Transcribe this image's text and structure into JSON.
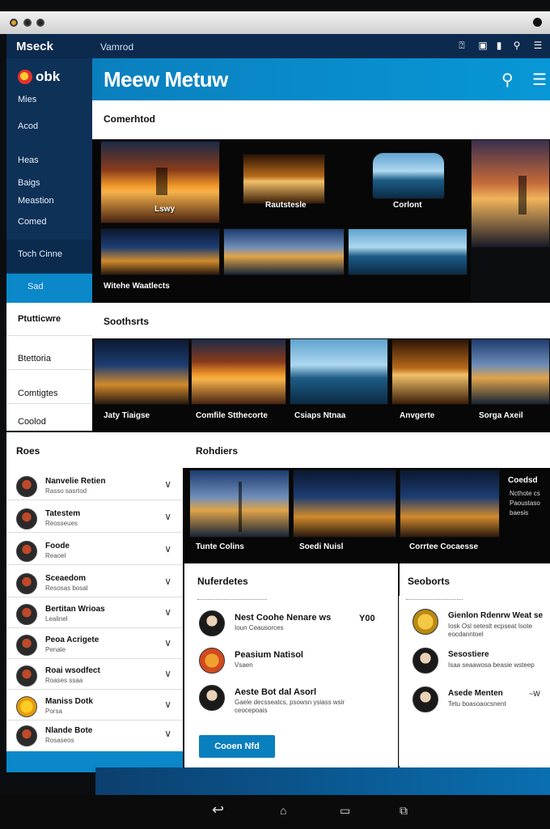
{
  "window": {
    "brand": "Mseck",
    "crumb": "Vamrod"
  },
  "sidebar": {
    "logo_text": "obk",
    "items": [
      "Mies",
      "Acod",
      "Heas",
      "Baigs",
      "Meastion",
      "Comed",
      "Toch Cinne",
      "Sad"
    ],
    "sections": [
      "Ptutticwre",
      "Btettoria",
      "Comtigtes",
      "Coolod"
    ],
    "roes_label": "Roes"
  },
  "banner": {
    "title": "Meew Metuw"
  },
  "featured": {
    "title": "Comerhtod",
    "tiles": [
      "Lswy",
      "Rautstesle",
      "Corlont",
      "Witehe Waatlects"
    ]
  },
  "sotheerts": {
    "title": "Soothsrts",
    "tiles": [
      "Jaty Tiaigse",
      "Comfile Stthecorte",
      "Csiaps Ntnaa",
      "Anvgerte",
      "Sorga Axeil"
    ]
  },
  "list": {
    "rows": [
      {
        "title": "Nanvelie Retien",
        "sub": "Rasso sasrtod"
      },
      {
        "title": "Tatestem",
        "sub": "Reosseues"
      },
      {
        "title": "Foode",
        "sub": "Reaoel"
      },
      {
        "title": "Sceaedom",
        "sub": "Resosas bosal"
      },
      {
        "title": "Bertitan Wrioas",
        "sub": "Lealinel"
      },
      {
        "title": "Peoa Acrigete",
        "sub": "Penale"
      },
      {
        "title": "Roai wsodfect",
        "sub": "Roases ssaa"
      },
      {
        "title": "Maniss Dotk",
        "sub": "Porsa"
      },
      {
        "title": "Nlande Bote",
        "sub": "Rosaseos"
      }
    ]
  },
  "rohders": {
    "title": "Rohdiers",
    "tiles": [
      "Tunte Colins",
      "Soedi Nuisl",
      "Corrtee Cocaesse"
    ],
    "side_title": "Coedsd",
    "side_text": "Ncthote cs Paoustaso baesis"
  },
  "nuferdetes": {
    "title": "Nuferdetes",
    "posts": [
      {
        "title": "Nest Coohe Nenare ws",
        "sub": "Ioun Ceausorces",
        "meta": "Y00"
      },
      {
        "title": "Peasium Natisol",
        "sub": "Vsaen"
      },
      {
        "title": "Aeste Bot dal Asorl",
        "sub": "Gaele decsseatcs, psowsn ysiass wsir ceocepoais"
      }
    ],
    "button": "Cooen Nfd"
  },
  "seoborts": {
    "title": "Seoborts",
    "posts": [
      {
        "title": "Gienlon Rdenrw Weat se",
        "sub": "Iosk Osl seteslt ecpseat Isote eocdanntoel"
      },
      {
        "title": "Sesostiere",
        "sub": "Isaa seaawosa beasie wsteep"
      },
      {
        "title": "Asede Menten",
        "sub": "Tetu boasoaocsnent",
        "meta": "~W"
      }
    ]
  }
}
